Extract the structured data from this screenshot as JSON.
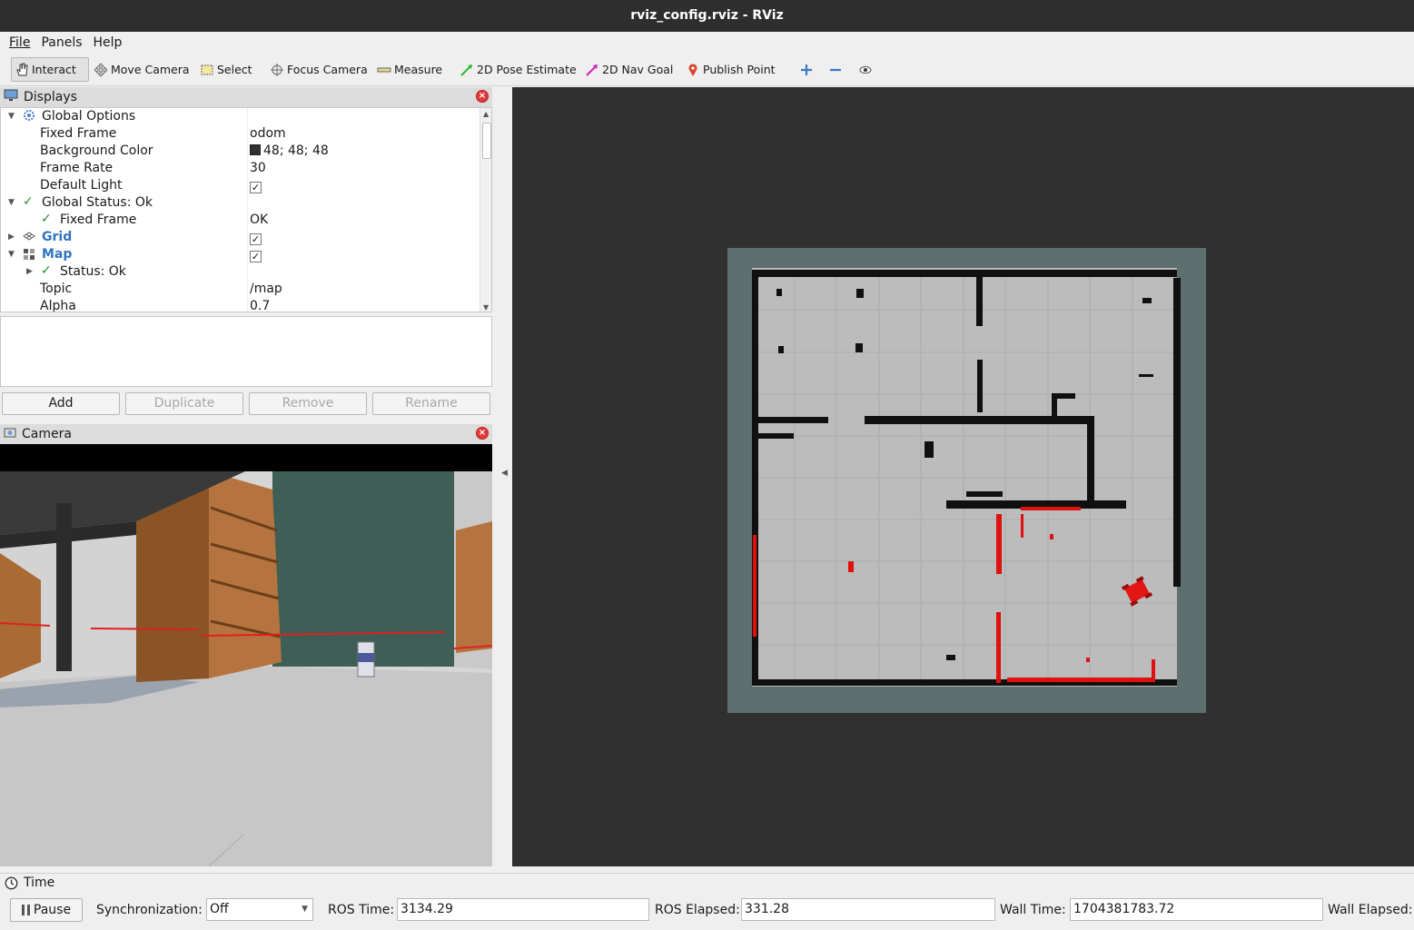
{
  "window": {
    "title": "rviz_config.rviz - RViz"
  },
  "menu": {
    "file": "File",
    "panels": "Panels",
    "help": "Help"
  },
  "toolbar": {
    "interact": "Interact",
    "move_camera": "Move Camera",
    "select": "Select",
    "focus_camera": "Focus Camera",
    "measure": "Measure",
    "pose_estimate": "2D Pose Estimate",
    "nav_goal": "2D Nav Goal",
    "publish_point": "Publish Point"
  },
  "displays": {
    "title": "Displays",
    "rows": [
      {
        "key": "Global Options",
        "value": ""
      },
      {
        "key": "Fixed Frame",
        "value": "odom"
      },
      {
        "key": "Background Color",
        "value": "48; 48; 48"
      },
      {
        "key": "Frame Rate",
        "value": "30"
      },
      {
        "key": "Default Light",
        "value": ""
      },
      {
        "key": "Global Status: Ok",
        "value": ""
      },
      {
        "key": "Fixed Frame",
        "value": "OK"
      },
      {
        "key": "Grid",
        "value": ""
      },
      {
        "key": "Map",
        "value": ""
      },
      {
        "key": "Status: Ok",
        "value": ""
      },
      {
        "key": "Topic",
        "value": "/map"
      },
      {
        "key": "Alpha",
        "value": "0.7"
      }
    ],
    "buttons": {
      "add": "Add",
      "duplicate": "Duplicate",
      "remove": "Remove",
      "rename": "Rename"
    },
    "colors": {
      "background_swatch": "#303030",
      "group_label": "#2f73c0"
    }
  },
  "camera": {
    "title": "Camera"
  },
  "time": {
    "title": "Time",
    "pause": "Pause",
    "sync_label": "Synchronization:",
    "sync_value": "Off",
    "ros_time_label": "ROS Time:",
    "ros_time": "3134.29",
    "ros_elapsed_label": "ROS Elapsed:",
    "ros_elapsed": "331.28",
    "wall_time_label": "Wall Time:",
    "wall_time": "1704381783.72",
    "wall_elapsed_label": "Wall Elapsed:"
  }
}
